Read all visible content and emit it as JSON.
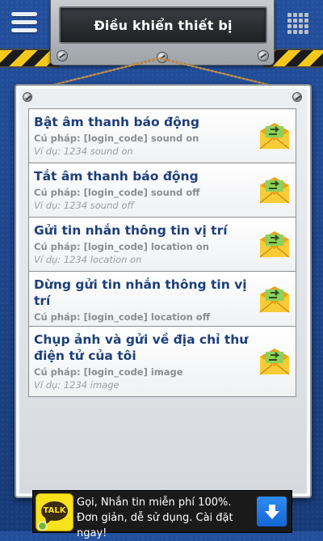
{
  "header": {
    "title": "Điều khiển thiết bị",
    "menu_icon": "hamburger-menu-icon",
    "apps_icon": "grid-apps-icon"
  },
  "commands": [
    {
      "title": "Bật âm thanh báo động",
      "syntax": "Cú pháp: [login_code] sound on",
      "example": "Ví dụ: 1234 sound on"
    },
    {
      "title": "Tắt âm thanh báo động",
      "syntax": "Cú pháp: [login_code] sound off",
      "example": "Ví dụ: 1234 sound off"
    },
    {
      "title": "Gửi tin nhắn thông tin vị trí",
      "syntax": "Cú pháp: [login_code] location on",
      "example": "Ví dụ: 1234 location on"
    },
    {
      "title": "Dừng gửi tin nhắn thông tin vị trí",
      "syntax": "Cú pháp: [login_code] location off",
      "example": "Ví dụ: 1234 location off"
    },
    {
      "title": "Chụp ảnh và gửi về địa chỉ thư điện tử của tôi",
      "syntax": "Cú pháp: [login_code] image",
      "example": "Ví dụ: 1234 image"
    }
  ],
  "ad": {
    "logo_text": "TALK",
    "text": "Gọi, Nhắn tin miễn phí 100%. Đơn giản, dễ sử dụng. Cài đặt ngay!",
    "button_icon": "download-arrow-icon"
  },
  "colors": {
    "background": "#1c3f86",
    "title_text": "#1d3f7a",
    "hazard_yellow": "#f5c81c",
    "ad_button": "#1e78e8"
  }
}
